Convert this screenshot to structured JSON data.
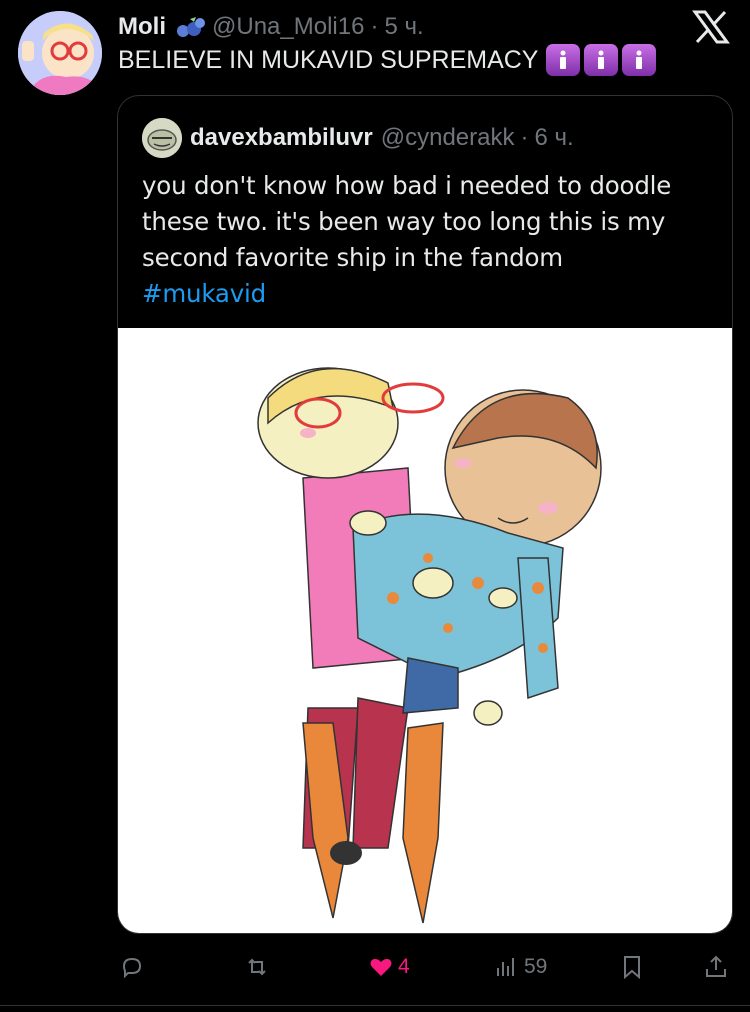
{
  "post": {
    "author_name": "Moli",
    "handle": "@Una_Moli16",
    "separator": "·",
    "time": "5 ч.",
    "text": "BELIEVE IN MUKAVID SUPREMACY",
    "emoji": [
      "info-emoji",
      "info-emoji",
      "info-emoji"
    ]
  },
  "quote": {
    "author_name": "davexbambiluvr",
    "handle": "@cynderakk",
    "separator": "·",
    "time": "6 ч.",
    "text": "you don't know how bad i needed to doodle these two. it's been way too long this is my second favorite ship in the fandom",
    "hashtag": "#mukavid"
  },
  "actions": {
    "reply_count": "",
    "repost_count": "",
    "like_count": "4",
    "views_count": "59"
  },
  "colors": {
    "background": "#000000",
    "text": "#e7e9ea",
    "muted": "#71767b",
    "link": "#1d9bf0",
    "like": "#f91880",
    "border": "#2f3336"
  },
  "icons": [
    "x-logo-icon",
    "blueberry-icon",
    "reply-icon",
    "repost-icon",
    "heart-icon",
    "views-icon",
    "bookmark-icon",
    "share-icon"
  ]
}
